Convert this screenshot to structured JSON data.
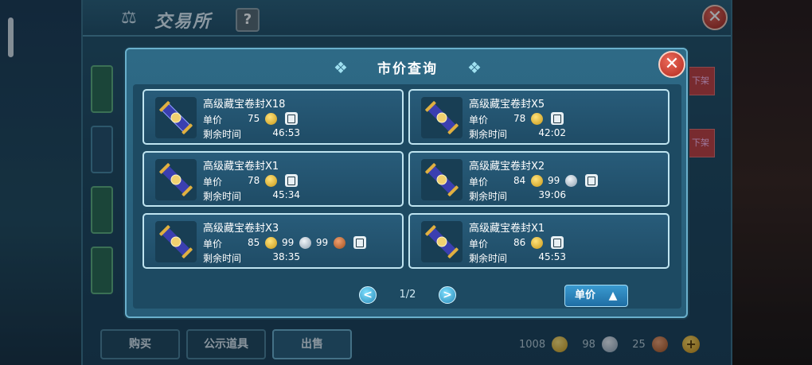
{
  "background_window": {
    "title": "交易所",
    "help_label": "?",
    "close_label": "✕",
    "side_tag_label": "下架",
    "tabs": [
      {
        "label": "购买"
      },
      {
        "label": "公示道具"
      },
      {
        "label": "出售"
      }
    ],
    "currencies": [
      {
        "amount": "1008",
        "type": "gold"
      },
      {
        "amount": "98",
        "type": "silver"
      },
      {
        "amount": "25",
        "type": "copper"
      }
    ],
    "add_label": "+"
  },
  "modal": {
    "title": "市价查询",
    "close_label": "✕",
    "price_label": "单价",
    "time_label": "剩余时间",
    "listings": [
      {
        "name": "高级藏宝卷封X18",
        "prices": [
          {
            "amount": "75",
            "coin": "gold"
          }
        ],
        "time": "46:53"
      },
      {
        "name": "高级藏宝卷封X5",
        "prices": [
          {
            "amount": "78",
            "coin": "gold"
          }
        ],
        "time": "42:02"
      },
      {
        "name": "高级藏宝卷封X1",
        "prices": [
          {
            "amount": "78",
            "coin": "gold"
          }
        ],
        "time": "45:34"
      },
      {
        "name": "高级藏宝卷封X2",
        "prices": [
          {
            "amount": "84",
            "coin": "gold"
          },
          {
            "amount": "99",
            "coin": "silver"
          }
        ],
        "time": "39:06"
      },
      {
        "name": "高级藏宝卷封X3",
        "prices": [
          {
            "amount": "85",
            "coin": "gold"
          },
          {
            "amount": "99",
            "coin": "silver"
          },
          {
            "amount": "99",
            "coin": "copper"
          }
        ],
        "time": "38:35"
      },
      {
        "name": "高级藏宝卷封X1",
        "prices": [
          {
            "amount": "86",
            "coin": "gold"
          }
        ],
        "time": "45:53"
      }
    ],
    "pagination": {
      "text": "1/2",
      "prev": "<",
      "next": ">"
    },
    "sort_button": {
      "label": "单价",
      "direction": "ascending"
    }
  }
}
